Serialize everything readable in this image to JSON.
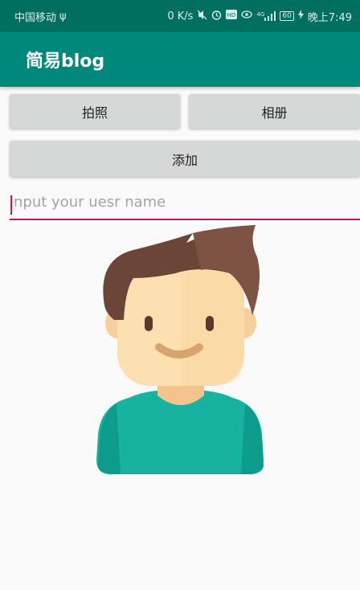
{
  "status_bar": {
    "carrier": "中国移动",
    "usb_symbol": "ψ",
    "net_speed": "0 K/s",
    "signal_label": "4G",
    "battery": "60",
    "time": "晚上7:49"
  },
  "app_bar": {
    "title": "简易blog"
  },
  "buttons": {
    "photo_label": "拍照",
    "album_label": "相册",
    "add_label": "添加"
  },
  "name_input": {
    "placeholder": "input your uesr name",
    "value": ""
  },
  "colors": {
    "status_bar": "#006f5f",
    "app_bar": "#00897b",
    "accent": "#c2185b",
    "button": "#d6d7d7"
  }
}
